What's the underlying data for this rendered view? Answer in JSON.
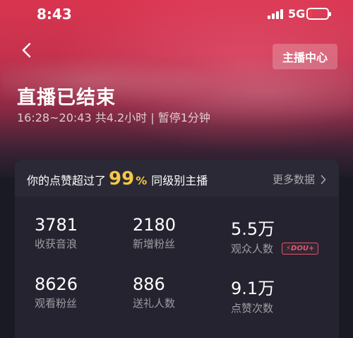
{
  "status_bar": {
    "time": "8:43",
    "network": "5G",
    "battery_level": 0.15,
    "battery_color": "#ff3b30"
  },
  "header": {
    "back_icon": "chevron-left-icon",
    "host_center_label": "主播中心",
    "title": "直播已结束",
    "subtitle": "16:28~20:43 共4.2小时 | 暂停1分钟"
  },
  "summary": {
    "prefix": "你的点赞超过了",
    "percent": "99",
    "percent_symbol": "%",
    "suffix": "同级别主播",
    "more_label": "更多数据",
    "accent_color": "#f7c744"
  },
  "stats": [
    {
      "value": "3781",
      "label": "收获音浪"
    },
    {
      "value": "2180",
      "label": "新增粉丝"
    },
    {
      "value": "5.5万",
      "label": "观众人数",
      "badge": "DOU+"
    },
    {
      "value": "8626",
      "label": "观看粉丝"
    },
    {
      "value": "886",
      "label": "送礼人数"
    },
    {
      "value": "9.1万",
      "label": "点赞次数"
    }
  ]
}
